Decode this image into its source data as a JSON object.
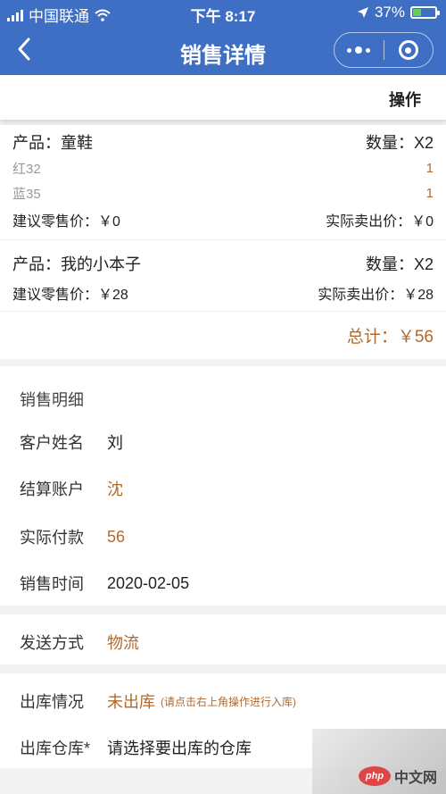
{
  "status_bar": {
    "carrier": "中国联通",
    "time": "下午 8:17",
    "battery": "37%",
    "battery_level": 0.37
  },
  "nav": {
    "title": "销售详情"
  },
  "toolbar": {
    "operate_label": "操作"
  },
  "products": [
    {
      "name_label": "产品：童鞋",
      "qty_label": "数量：X2",
      "variants": [
        {
          "name": "红32",
          "qty": "1"
        },
        {
          "name": "蓝35",
          "qty": "1"
        }
      ],
      "retail_label": "建议零售价：￥0",
      "actual_label": "实际卖出价：￥0"
    },
    {
      "name_label": "产品：我的小本子",
      "qty_label": "数量：X2",
      "variants": [],
      "retail_label": "建议零售价：￥28",
      "actual_label": "实际卖出价：￥28"
    }
  ],
  "total_label": "总计：￥56",
  "detail": {
    "section_title": "销售明细",
    "fields": [
      {
        "label": "客户姓名",
        "value": "刘"
      },
      {
        "label": "结算账户",
        "value": "沈"
      },
      {
        "label": "实际付款",
        "value": "56"
      },
      {
        "label": "销售时间",
        "value": "2020-02-05"
      }
    ]
  },
  "shipping": {
    "label": "发送方式",
    "value": "物流"
  },
  "stock": {
    "status_label": "出库情况",
    "status_value": "未出库",
    "status_note": "(请点击右上角操作进行入库)",
    "warehouse_label": "出库仓库*",
    "warehouse_placeholder": "请选择要出库的仓库"
  },
  "watermark": {
    "logo": "php",
    "text": "中文网"
  },
  "colors": {
    "nav_blue": "#3f6fc4",
    "accent_brown": "#b06a2f"
  },
  "icons": [
    "signal-icon",
    "wifi-icon",
    "location-arrow-icon",
    "battery-icon",
    "back-arrow-icon",
    "more-dots-icon",
    "close-circle-icon"
  ]
}
